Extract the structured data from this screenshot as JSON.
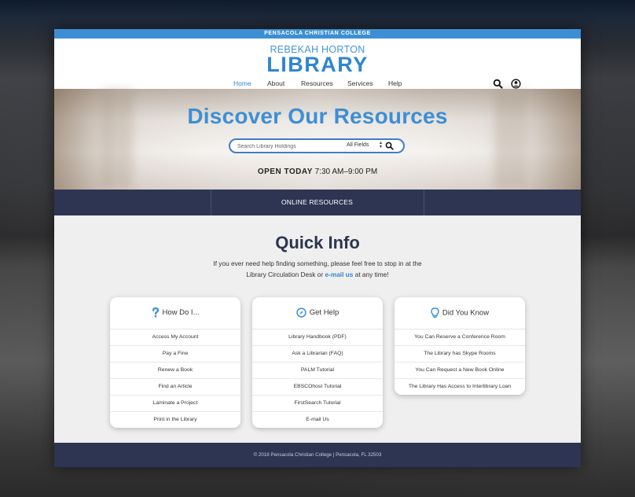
{
  "topbar": {
    "college": "PENSACOLA CHRISTIAN COLLEGE"
  },
  "logo": {
    "line1": "REBEKAH HORTON",
    "line2": "LIBRARY"
  },
  "nav": {
    "items": [
      "Home",
      "About",
      "Resources",
      "Services",
      "Help"
    ],
    "active": "Home"
  },
  "icons": {
    "search": "search-icon",
    "account": "user-account-icon"
  },
  "hero": {
    "title": "Discover Our Resources",
    "search_placeholder": "Search Library Holdings",
    "search_scope": "All Fields",
    "hours_label": "OPEN TODAY",
    "hours_value": "7:30 AM–9:00 PM"
  },
  "resources_bar": {
    "label": "ONLINE RESOURCES"
  },
  "quick_info": {
    "title": "Quick Info",
    "text_line1": "If you ever need help finding something, please feel free to stop in at the",
    "text_line2_before": "Library Circulation Desk or ",
    "text_link": "e-mail us",
    "text_line2_after": " at any time!"
  },
  "cards": [
    {
      "title": "How Do I...",
      "icon": "question-mark-icon",
      "items": [
        "Access My Account",
        "Pay a Fine",
        "Renew a Book",
        "Find an Article",
        "Laminate a Project",
        "Print in the Library"
      ]
    },
    {
      "title": "Get Help",
      "icon": "compass-icon",
      "items": [
        "Library Handbook (PDF)",
        "Ask a Librarian (FAQ)",
        "PALM Tutorial",
        "EBSCOhost Tutorial",
        "FirstSearch Tutorial",
        "E-mail Us"
      ]
    },
    {
      "title": "Did You Know",
      "icon": "lightbulb-icon",
      "items": [
        "You Can Reserve a Conference Room",
        "The Library has Skype Rooms",
        "You Can Request a New Book Online",
        "The Library Has Access to Interlibrary Loan"
      ]
    }
  ],
  "footer": {
    "text": "© 2018 Pensacola Christian College | Pensacola, FL 32503"
  },
  "colors": {
    "accent": "#3d8fd4",
    "navy": "#2e3553",
    "background": "#efefef"
  }
}
